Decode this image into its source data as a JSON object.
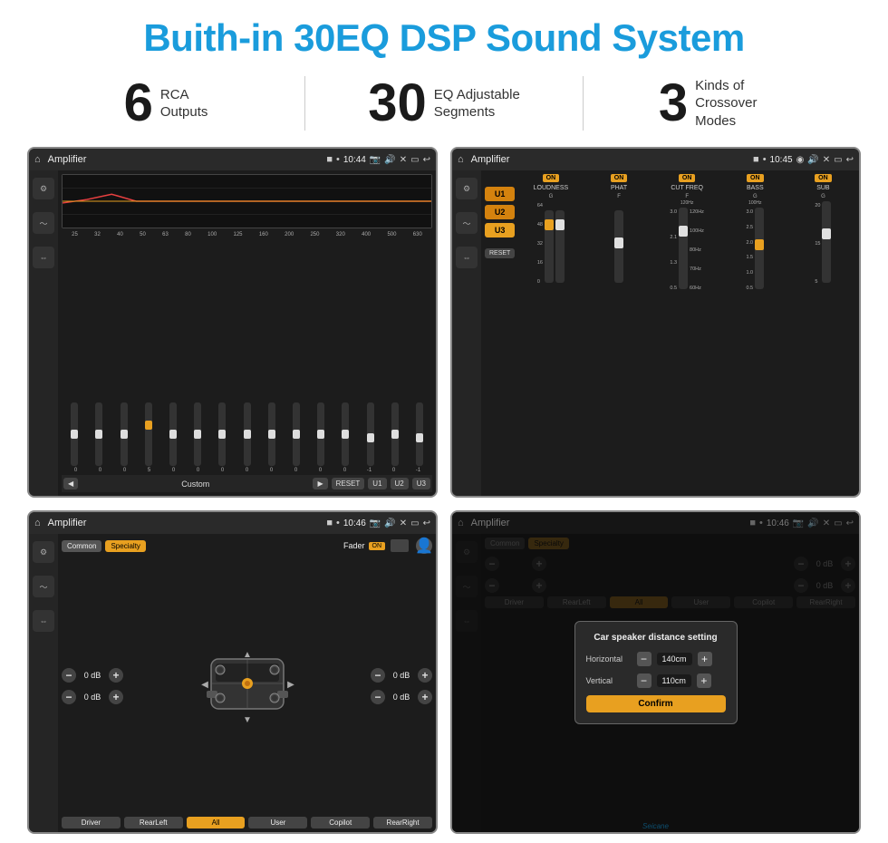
{
  "page": {
    "title": "Buith-in 30EQ DSP Sound System",
    "brand": "Seicane"
  },
  "stats": [
    {
      "number": "6",
      "label": "RCA\nOutputs"
    },
    {
      "number": "30",
      "label": "EQ Adjustable\nSegments"
    },
    {
      "number": "3",
      "label": "Kinds of\nCrossover Modes"
    }
  ],
  "screen1": {
    "title": "Amplifier",
    "time": "10:44",
    "freq_labels": [
      "25",
      "32",
      "40",
      "50",
      "63",
      "80",
      "100",
      "125",
      "160",
      "200",
      "250",
      "320",
      "400",
      "500",
      "630"
    ],
    "values": [
      "0",
      "0",
      "0",
      "5",
      "0",
      "0",
      "0",
      "0",
      "0",
      "0",
      "0",
      "0",
      "-1",
      "0",
      "-1"
    ],
    "bottom_label": "Custom",
    "buttons": [
      "RESET",
      "U1",
      "U2",
      "U3"
    ]
  },
  "screen2": {
    "title": "Amplifier",
    "time": "10:45",
    "channels": [
      {
        "on": true,
        "label": "LOUDNESS"
      },
      {
        "on": true,
        "label": "PHAT"
      },
      {
        "on": true,
        "label": "CUT FREQ"
      },
      {
        "on": true,
        "label": "BASS"
      },
      {
        "on": true,
        "label": "SUB"
      }
    ],
    "u_buttons": [
      "U1",
      "U2",
      "U3"
    ],
    "reset_label": "RESET"
  },
  "screen3": {
    "title": "Amplifier",
    "time": "10:46",
    "tabs": [
      "Common",
      "Specialty"
    ],
    "fader_label": "Fader",
    "on_badge": "ON",
    "volumes": [
      {
        "label": "0 dB"
      },
      {
        "label": "0 dB"
      },
      {
        "label": "0 dB"
      },
      {
        "label": "0 dB"
      }
    ],
    "zone_buttons": [
      "Driver",
      "RearLeft",
      "All",
      "User",
      "Copilot",
      "RearRight"
    ]
  },
  "screen4": {
    "title": "Amplifier",
    "time": "10:46",
    "tabs": [
      "Common",
      "Specialty"
    ],
    "dialog": {
      "title": "Car speaker distance setting",
      "horizontal_label": "Horizontal",
      "horizontal_value": "140cm",
      "vertical_label": "Vertical",
      "vertical_value": "110cm",
      "confirm_label": "Confirm"
    },
    "db_labels": [
      "0 dB",
      "0 dB"
    ],
    "zone_buttons": [
      "Driver",
      "RearLeft",
      "All",
      "User",
      "Copilot",
      "RearRight"
    ]
  },
  "icons": {
    "home": "⌂",
    "location": "◉",
    "volume": "🔊",
    "close": "✕",
    "back": "↩",
    "arrow_left": "◀",
    "arrow_right": "▶",
    "expand": "≫",
    "settings": "⚙",
    "on": "ON"
  }
}
